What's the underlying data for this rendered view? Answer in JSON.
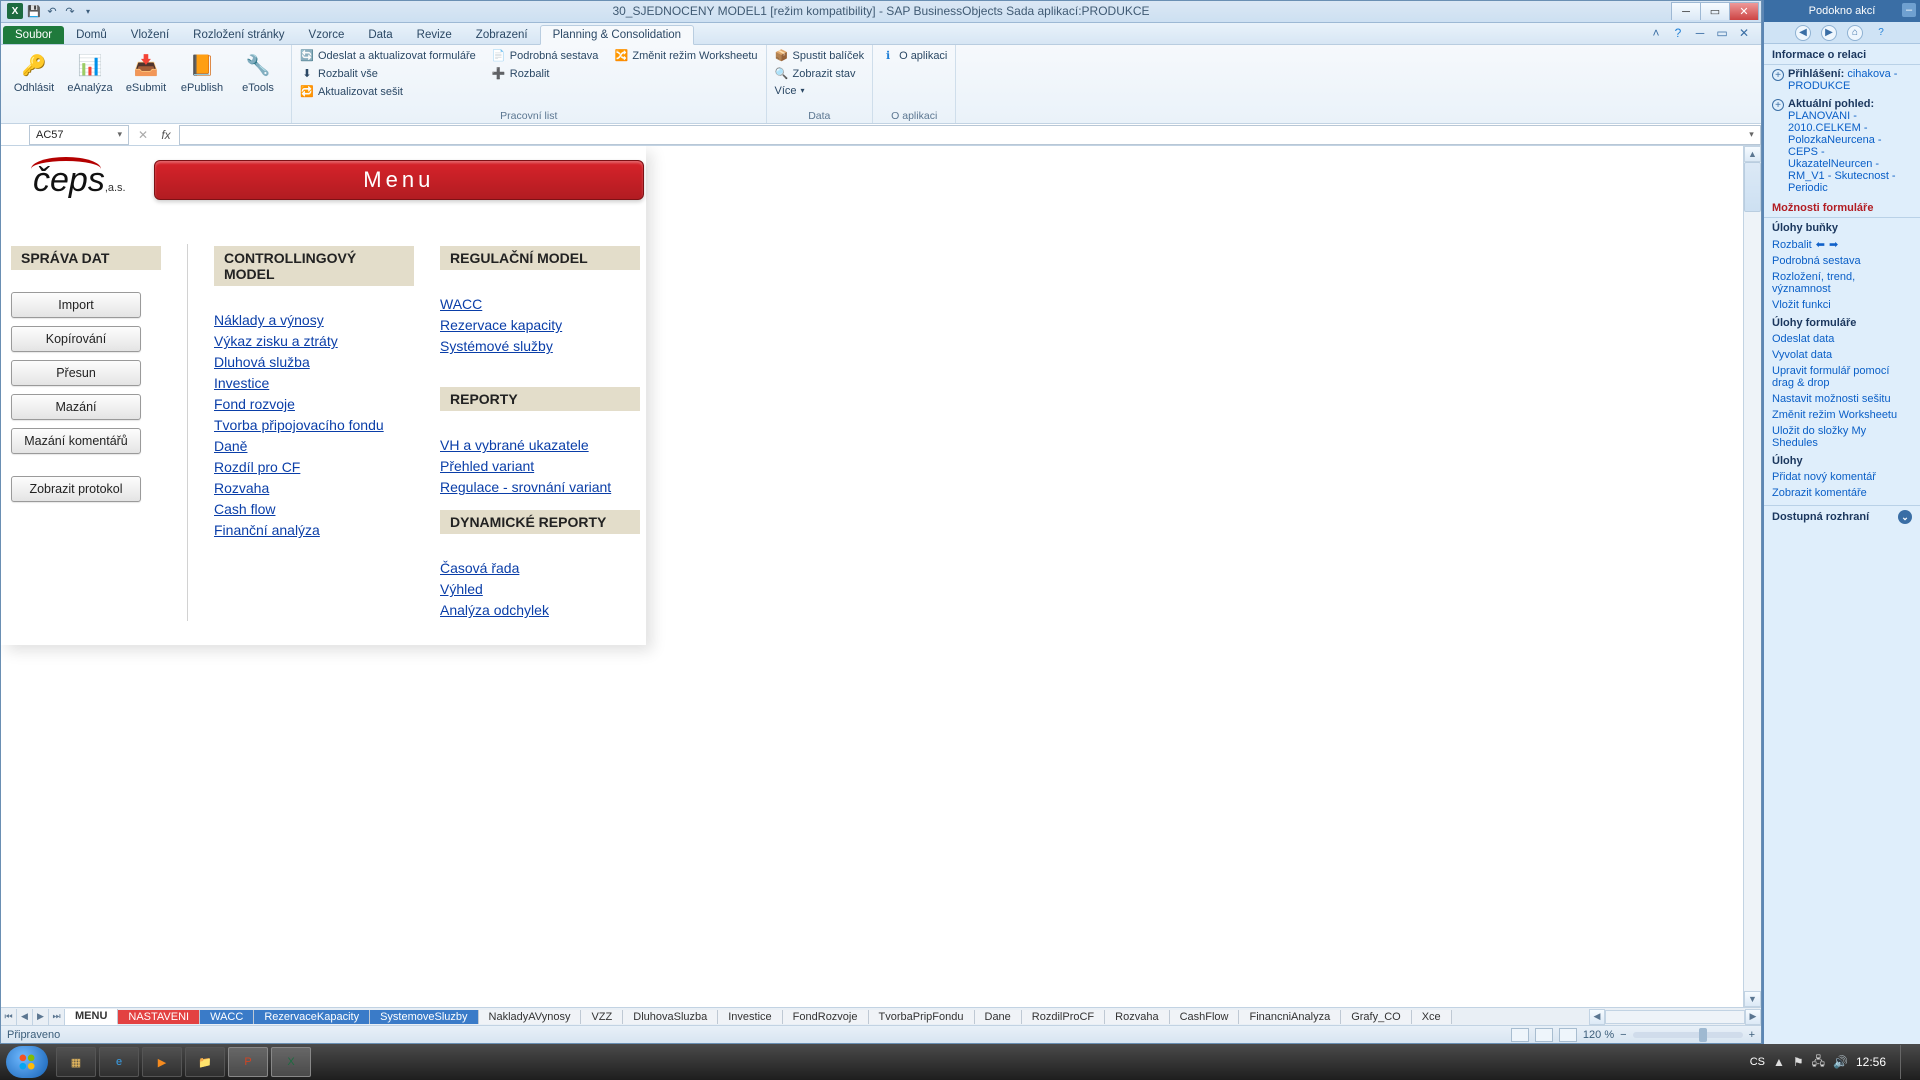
{
  "titlebar": {
    "title": "30_SJEDNOCENY MODEL1  [režim kompatibility]  -  SAP BusinessObjects    Sada aplikací:PRODUKCE"
  },
  "ribbon_tabs": {
    "file": "Soubor",
    "tabs": [
      "Domů",
      "Vložení",
      "Rozložení stránky",
      "Vzorce",
      "Data",
      "Revize",
      "Zobrazení",
      "Planning & Consolidation"
    ],
    "active_index": 7
  },
  "ribbon": {
    "group1": {
      "logout": "Odhlásit",
      "eanalyza": "eAnalýza",
      "esubmit": "eSubmit",
      "epublish": "ePublish",
      "etools": "eTools"
    },
    "group2": {
      "cmd1": "Odeslat a aktualizovat formuláře",
      "cmd2": "Rozbalit vše",
      "cmd3": "Aktualizovat sešit",
      "cmd4": "Podrobná sestava",
      "cmd5": "Rozbalit",
      "cmd6": "Změnit režim Worksheetu",
      "label": "Pracovní list"
    },
    "group3": {
      "cmd1": "Spustit balíček",
      "cmd2": "Zobrazit stav",
      "cmd3": "Více",
      "label": "Data"
    },
    "group4": {
      "cmd1": "O aplikaci",
      "label": "O aplikaci"
    }
  },
  "formula_bar": {
    "cell_ref": "AC57"
  },
  "menu": {
    "title": "Menu",
    "logo": "čeps",
    "logo_sub": ",a.s.",
    "sprava_dat": "SPRÁVA DAT",
    "buttons": [
      "Import",
      "Kopírování",
      "Přesun",
      "Mazání",
      "Mazání  komentářů",
      "Zobrazit  protokol"
    ],
    "controlling": "CONTROLLINGOVÝ MODEL",
    "controlling_links": [
      "Náklady a výnosy",
      "Výkaz zisku a ztráty",
      "Dluhová služba",
      "Investice",
      "Fond rozvoje",
      "Tvorba připojovacího fondu",
      "Daně",
      "Rozdíl pro CF",
      "Rozvaha",
      "Cash flow",
      "Finanční analýza"
    ],
    "regulacni": "REGULAČNÍ MODEL",
    "regulacni_links": [
      "WACC",
      "Rezervace kapacity",
      "Systémové služby"
    ],
    "reporty": "REPORTY",
    "reporty_links": [
      "VH a vybrané ukazatele",
      "Přehled variant",
      "Regulace - srovnání variant"
    ],
    "dynamicke": "DYNAMICKÉ REPORTY",
    "dynamicke_links": [
      "Časová řada",
      "Výhled",
      "Analýza odchylek"
    ]
  },
  "sheet_tabs": [
    "MENU",
    "NASTAVENI",
    "WACC",
    "RezervaceKapacity",
    "SystemoveSluzby",
    "NakladyAVynosy",
    "VZZ",
    "DluhovaSluzba",
    "Investice",
    "FondRozvoje",
    "TvorbaPripFondu",
    "Dane",
    "RozdilProCF",
    "Rozvaha",
    "CashFlow",
    "FinancniAnalyza",
    "Grafy_CO",
    "Xce"
  ],
  "statusbar": {
    "ready": "Připraveno",
    "zoom": "120 %"
  },
  "action_pane": {
    "title": "Podokno akcí",
    "section_info": "Informace o relaci",
    "login_label": "Přihlášení:",
    "login_value": "cihakova - PRODUKCE",
    "view_label": "Aktuální pohled:",
    "view_value": "PLANOVANI - 2010.CELKEM - PolozkaNeurcena - CEPS - UkazatelNeurcen - RM_V1 - Skutecnost - Periodic",
    "section_form": "Možnosti formuláře",
    "sub_cell": "Úlohy buňky",
    "cell_links": [
      "Rozbalit",
      "Podrobná sestava",
      "Rozložení,  trend,  významnost",
      "Vložit funkci"
    ],
    "sub_form": "Úlohy formuláře",
    "form_links": [
      "Odeslat data",
      "Vyvolat data",
      "Upravit formulář pomocí drag & drop",
      "Nastavit možnosti sešitu",
      "Změnit režim Worksheetu",
      "Uložit do složky My Shedules"
    ],
    "sub_tasks": "Úlohy",
    "task_links": [
      "Přidat nový komentář",
      "Zobrazit komentáře"
    ],
    "section_avail": "Dostupná rozhraní"
  },
  "taskbar": {
    "lang": "CS",
    "time": "12:56"
  }
}
